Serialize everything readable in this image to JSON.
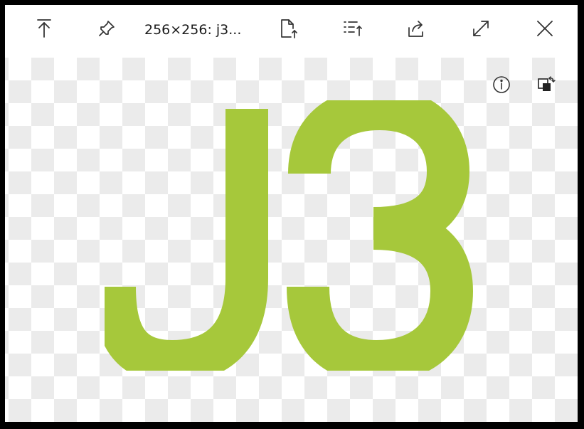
{
  "window": {
    "title": "256×256: j3..."
  },
  "toolbar": {
    "buttons": [
      {
        "icon": "arrow-up-to-top-icon",
        "action": "keep-on-top"
      },
      {
        "icon": "pin-icon",
        "action": "pin"
      },
      {
        "icon": "file-export-icon",
        "action": "save-as"
      },
      {
        "icon": "list-sort-icon",
        "action": "list"
      },
      {
        "icon": "share-icon",
        "action": "share"
      },
      {
        "icon": "expand-icon",
        "action": "full-screen"
      },
      {
        "icon": "close-icon",
        "action": "close"
      }
    ]
  },
  "viewer": {
    "info_icon": "info-icon",
    "background_toggle_icon": "swap-background-icon"
  },
  "image": {
    "logo_text": "J3",
    "logo_color": "#a6c83b",
    "checker_color": "#ebebeb"
  }
}
